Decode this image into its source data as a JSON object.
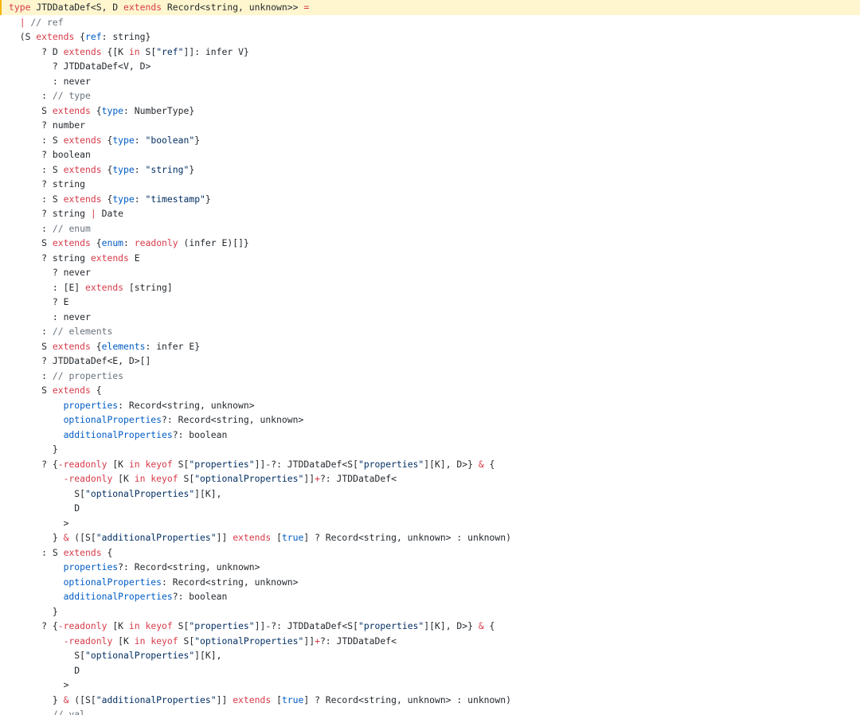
{
  "colors": {
    "background": "#ffffff",
    "active_line_bg": "#fff6cf",
    "active_line_marker": "#f5b400",
    "plain": "#24292e",
    "keyword": "#d73a49",
    "property": "#005cc5",
    "string": "#032f62",
    "comment": "#6a737d"
  },
  "code": {
    "lines": [
      {
        "indent": 0,
        "tokens": [
          [
            "kw",
            "type"
          ],
          [
            "plain",
            " JTDDataDef<S, D "
          ],
          [
            "kw",
            "extends"
          ],
          [
            "plain",
            " Record<string, unknown>> "
          ],
          [
            "kw",
            "="
          ]
        ]
      },
      {
        "indent": 2,
        "tokens": [
          [
            "op",
            "|"
          ],
          [
            "com",
            " // ref"
          ]
        ]
      },
      {
        "indent": 2,
        "tokens": [
          [
            "plain",
            "(S "
          ],
          [
            "kw",
            "extends"
          ],
          [
            "plain",
            " {"
          ],
          [
            "prop",
            "ref"
          ],
          [
            "plain",
            ": string}"
          ]
        ]
      },
      {
        "indent": 6,
        "tokens": [
          [
            "plain",
            "? D "
          ],
          [
            "kw",
            "extends"
          ],
          [
            "plain",
            " {[K "
          ],
          [
            "kw",
            "in"
          ],
          [
            "plain",
            " S["
          ],
          [
            "str",
            "\"ref\""
          ],
          [
            "plain",
            "]]: infer V}"
          ]
        ]
      },
      {
        "indent": 8,
        "tokens": [
          [
            "plain",
            "? JTDDataDef<V, D>"
          ]
        ]
      },
      {
        "indent": 8,
        "tokens": [
          [
            "plain",
            ": never"
          ]
        ]
      },
      {
        "indent": 6,
        "tokens": [
          [
            "plain",
            ": "
          ],
          [
            "com",
            "// type"
          ]
        ]
      },
      {
        "indent": 6,
        "tokens": [
          [
            "plain",
            "S "
          ],
          [
            "kw",
            "extends"
          ],
          [
            "plain",
            " {"
          ],
          [
            "prop",
            "type"
          ],
          [
            "plain",
            ": NumberType}"
          ]
        ]
      },
      {
        "indent": 6,
        "tokens": [
          [
            "plain",
            "? number"
          ]
        ]
      },
      {
        "indent": 6,
        "tokens": [
          [
            "plain",
            ": S "
          ],
          [
            "kw",
            "extends"
          ],
          [
            "plain",
            " {"
          ],
          [
            "prop",
            "type"
          ],
          [
            "plain",
            ": "
          ],
          [
            "str",
            "\"boolean\""
          ],
          [
            "plain",
            "}"
          ]
        ]
      },
      {
        "indent": 6,
        "tokens": [
          [
            "plain",
            "? boolean"
          ]
        ]
      },
      {
        "indent": 6,
        "tokens": [
          [
            "plain",
            ": S "
          ],
          [
            "kw",
            "extends"
          ],
          [
            "plain",
            " {"
          ],
          [
            "prop",
            "type"
          ],
          [
            "plain",
            ": "
          ],
          [
            "str",
            "\"string\""
          ],
          [
            "plain",
            "}"
          ]
        ]
      },
      {
        "indent": 6,
        "tokens": [
          [
            "plain",
            "? string"
          ]
        ]
      },
      {
        "indent": 6,
        "tokens": [
          [
            "plain",
            ": S "
          ],
          [
            "kw",
            "extends"
          ],
          [
            "plain",
            " {"
          ],
          [
            "prop",
            "type"
          ],
          [
            "plain",
            ": "
          ],
          [
            "str",
            "\"timestamp\""
          ],
          [
            "plain",
            "}"
          ]
        ]
      },
      {
        "indent": 6,
        "tokens": [
          [
            "plain",
            "? string "
          ],
          [
            "op",
            "|"
          ],
          [
            "plain",
            " Date"
          ]
        ]
      },
      {
        "indent": 6,
        "tokens": [
          [
            "plain",
            ": "
          ],
          [
            "com",
            "// enum"
          ]
        ]
      },
      {
        "indent": 6,
        "tokens": [
          [
            "plain",
            "S "
          ],
          [
            "kw",
            "extends"
          ],
          [
            "plain",
            " {"
          ],
          [
            "prop",
            "enum"
          ],
          [
            "plain",
            ": "
          ],
          [
            "kw",
            "readonly"
          ],
          [
            "plain",
            " (infer E)[]}"
          ]
        ]
      },
      {
        "indent": 6,
        "tokens": [
          [
            "plain",
            "? string "
          ],
          [
            "kw",
            "extends"
          ],
          [
            "plain",
            " E"
          ]
        ]
      },
      {
        "indent": 8,
        "tokens": [
          [
            "plain",
            "? never"
          ]
        ]
      },
      {
        "indent": 8,
        "tokens": [
          [
            "plain",
            ": [E] "
          ],
          [
            "kw",
            "extends"
          ],
          [
            "plain",
            " [string]"
          ]
        ]
      },
      {
        "indent": 8,
        "tokens": [
          [
            "plain",
            "? E"
          ]
        ]
      },
      {
        "indent": 8,
        "tokens": [
          [
            "plain",
            ": never"
          ]
        ]
      },
      {
        "indent": 6,
        "tokens": [
          [
            "plain",
            ": "
          ],
          [
            "com",
            "// elements"
          ]
        ]
      },
      {
        "indent": 6,
        "tokens": [
          [
            "plain",
            "S "
          ],
          [
            "kw",
            "extends"
          ],
          [
            "plain",
            " {"
          ],
          [
            "prop",
            "elements"
          ],
          [
            "plain",
            ": infer E}"
          ]
        ]
      },
      {
        "indent": 6,
        "tokens": [
          [
            "plain",
            "? JTDDataDef<E, D>[]"
          ]
        ]
      },
      {
        "indent": 6,
        "tokens": [
          [
            "plain",
            ": "
          ],
          [
            "com",
            "// properties"
          ]
        ]
      },
      {
        "indent": 6,
        "tokens": [
          [
            "plain",
            "S "
          ],
          [
            "kw",
            "extends"
          ],
          [
            "plain",
            " {"
          ]
        ]
      },
      {
        "indent": 10,
        "tokens": [
          [
            "prop",
            "properties"
          ],
          [
            "plain",
            ": Record<string, unknown>"
          ]
        ]
      },
      {
        "indent": 10,
        "tokens": [
          [
            "prop",
            "optionalProperties"
          ],
          [
            "plain",
            "?: Record<string, unknown>"
          ]
        ]
      },
      {
        "indent": 10,
        "tokens": [
          [
            "prop",
            "additionalProperties"
          ],
          [
            "plain",
            "?: boolean"
          ]
        ]
      },
      {
        "indent": 8,
        "tokens": [
          [
            "plain",
            "}"
          ]
        ]
      },
      {
        "indent": 6,
        "tokens": [
          [
            "plain",
            "? {"
          ],
          [
            "kw",
            "-readonly"
          ],
          [
            "plain",
            " [K "
          ],
          [
            "kw",
            "in"
          ],
          [
            "plain",
            " "
          ],
          [
            "kw",
            "keyof"
          ],
          [
            "plain",
            " S["
          ],
          [
            "str",
            "\"properties\""
          ],
          [
            "plain",
            "]]-?: JTDDataDef<S["
          ],
          [
            "str",
            "\"properties\""
          ],
          [
            "plain",
            "][K], D>} "
          ],
          [
            "kw",
            "&"
          ],
          [
            "plain",
            " {"
          ]
        ]
      },
      {
        "indent": 10,
        "tokens": [
          [
            "kw",
            "-readonly"
          ],
          [
            "plain",
            " [K "
          ],
          [
            "kw",
            "in"
          ],
          [
            "plain",
            " "
          ],
          [
            "kw",
            "keyof"
          ],
          [
            "plain",
            " S["
          ],
          [
            "str",
            "\"optionalProperties\""
          ],
          [
            "plain",
            "]]"
          ],
          [
            "kw",
            "+"
          ],
          [
            "plain",
            "?: JTDDataDef<"
          ]
        ]
      },
      {
        "indent": 12,
        "tokens": [
          [
            "plain",
            "S["
          ],
          [
            "str",
            "\"optionalProperties\""
          ],
          [
            "plain",
            "][K],"
          ]
        ]
      },
      {
        "indent": 12,
        "tokens": [
          [
            "plain",
            "D"
          ]
        ]
      },
      {
        "indent": 10,
        "tokens": [
          [
            "plain",
            ">"
          ]
        ]
      },
      {
        "indent": 8,
        "tokens": [
          [
            "plain",
            "} "
          ],
          [
            "kw",
            "&"
          ],
          [
            "plain",
            " ([S["
          ],
          [
            "str",
            "\"additionalProperties\""
          ],
          [
            "plain",
            "]] "
          ],
          [
            "kw",
            "extends"
          ],
          [
            "plain",
            " ["
          ],
          [
            "prop",
            "true"
          ],
          [
            "plain",
            "] ? Record<string, unknown> : unknown)"
          ]
        ]
      },
      {
        "indent": 6,
        "tokens": [
          [
            "plain",
            ": S "
          ],
          [
            "kw",
            "extends"
          ],
          [
            "plain",
            " {"
          ]
        ]
      },
      {
        "indent": 10,
        "tokens": [
          [
            "prop",
            "properties"
          ],
          [
            "plain",
            "?: Record<string, unknown>"
          ]
        ]
      },
      {
        "indent": 10,
        "tokens": [
          [
            "prop",
            "optionalProperties"
          ],
          [
            "plain",
            ": Record<string, unknown>"
          ]
        ]
      },
      {
        "indent": 10,
        "tokens": [
          [
            "prop",
            "additionalProperties"
          ],
          [
            "plain",
            "?: boolean"
          ]
        ]
      },
      {
        "indent": 8,
        "tokens": [
          [
            "plain",
            "}"
          ]
        ]
      },
      {
        "indent": 6,
        "tokens": [
          [
            "plain",
            "? {"
          ],
          [
            "kw",
            "-readonly"
          ],
          [
            "plain",
            " [K "
          ],
          [
            "kw",
            "in"
          ],
          [
            "plain",
            " "
          ],
          [
            "kw",
            "keyof"
          ],
          [
            "plain",
            " S["
          ],
          [
            "str",
            "\"properties\""
          ],
          [
            "plain",
            "]]-?: JTDDataDef<S["
          ],
          [
            "str",
            "\"properties\""
          ],
          [
            "plain",
            "][K], D>} "
          ],
          [
            "kw",
            "&"
          ],
          [
            "plain",
            " {"
          ]
        ]
      },
      {
        "indent": 10,
        "tokens": [
          [
            "kw",
            "-readonly"
          ],
          [
            "plain",
            " [K "
          ],
          [
            "kw",
            "in"
          ],
          [
            "plain",
            " "
          ],
          [
            "kw",
            "keyof"
          ],
          [
            "plain",
            " S["
          ],
          [
            "str",
            "\"optionalProperties\""
          ],
          [
            "plain",
            "]]"
          ],
          [
            "kw",
            "+"
          ],
          [
            "plain",
            "?: JTDDataDef<"
          ]
        ]
      },
      {
        "indent": 12,
        "tokens": [
          [
            "plain",
            "S["
          ],
          [
            "str",
            "\"optionalProperties\""
          ],
          [
            "plain",
            "][K],"
          ]
        ]
      },
      {
        "indent": 12,
        "tokens": [
          [
            "plain",
            "D"
          ]
        ]
      },
      {
        "indent": 10,
        "tokens": [
          [
            "plain",
            ">"
          ]
        ]
      },
      {
        "indent": 8,
        "tokens": [
          [
            "plain",
            "} "
          ],
          [
            "kw",
            "&"
          ],
          [
            "plain",
            " ([S["
          ],
          [
            "str",
            "\"additionalProperties\""
          ],
          [
            "plain",
            "]] "
          ],
          [
            "kw",
            "extends"
          ],
          [
            "plain",
            " ["
          ],
          [
            "prop",
            "true"
          ],
          [
            "plain",
            "] ? Record<string, unknown> : unknown)"
          ]
        ]
      },
      {
        "indent": 8,
        "tokens": [
          [
            "com",
            "// val"
          ]
        ]
      }
    ]
  }
}
